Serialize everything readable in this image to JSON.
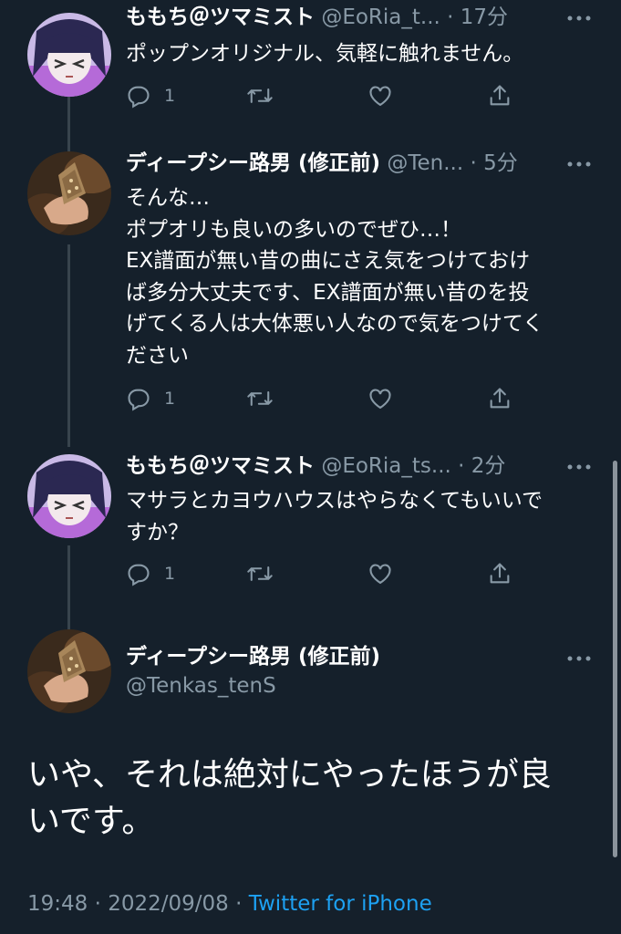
{
  "tweets": [
    {
      "name": "ももち＠ツマミスト",
      "handle": "@EoRia_t...",
      "separator": "·",
      "time": "17分",
      "lines": [
        "ポップンオリジナル、気軽に触れません。"
      ],
      "reply_count": "1",
      "avatar": "anime-girl-avatar"
    },
    {
      "name": "ディープシー路男 (修正前)",
      "handle": "@Ten...",
      "separator": "·",
      "time": "5分",
      "lines": [
        "そんな…",
        "ポプオリも良いの多いのでぜひ…！",
        "EX譜面が無い昔の曲にさえ気をつけておけ",
        "ば多分大丈夫です、EX譜面が無い昔のを投",
        "げてくる人は大体悪い人なので気をつけてく",
        "ださい"
      ],
      "reply_count": "1",
      "avatar": "hand-photo-avatar"
    },
    {
      "name": "ももち＠ツマミスト",
      "handle": "@EoRia_ts...",
      "separator": "·",
      "time": "2分",
      "lines": [
        "マサラとカヨウハウスはやらなくてもいいで",
        "すか？"
      ],
      "reply_count": "1",
      "avatar": "anime-girl-avatar"
    }
  ],
  "focused": {
    "name": "ディープシー路男 (修正前)",
    "handle": "@Tenkas_tenS",
    "lines": [
      "いや、それは絶対にやったほうが良",
      "いです。"
    ],
    "time": "19:48",
    "separator1": "·",
    "date": "2022/09/08",
    "separator2": "·",
    "source": "Twitter for iPhone"
  },
  "icons": {
    "reply": "reply-icon",
    "retweet": "retweet-icon",
    "like": "like-icon",
    "share": "share-icon",
    "more": "more-icon"
  },
  "colors": {
    "background": "#15202b",
    "muted": "#8899a6",
    "link": "#1da1f2",
    "thread_line": "#38444d"
  }
}
